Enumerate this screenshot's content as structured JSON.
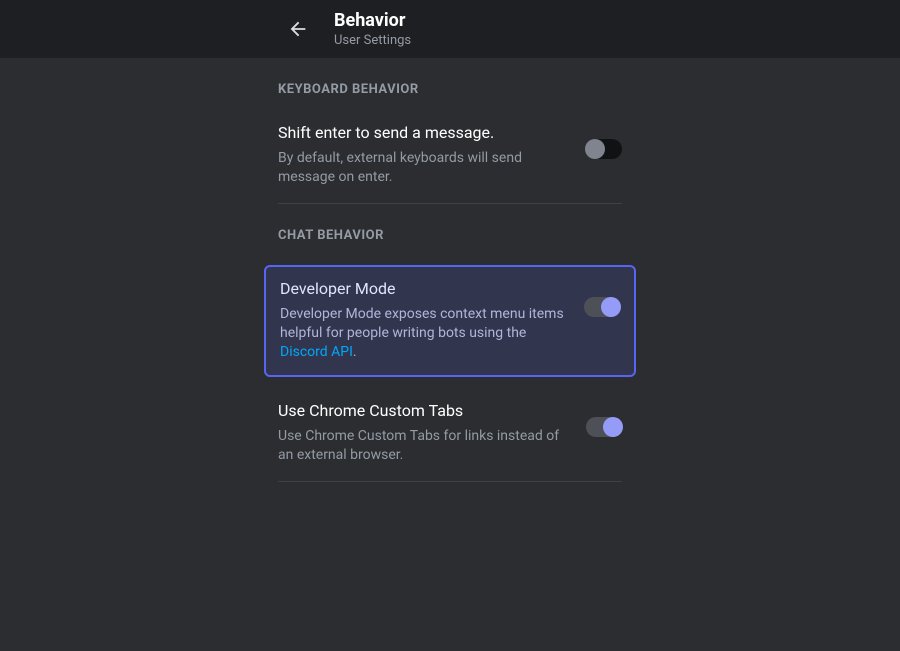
{
  "header": {
    "title": "Behavior",
    "subtitle": "User Settings"
  },
  "sections": {
    "keyboard": {
      "header": "KEYBOARD BEHAVIOR",
      "shiftEnter": {
        "title": "Shift enter to send a message.",
        "desc": "By default, external keyboards will send message on enter.",
        "enabled": false
      }
    },
    "chat": {
      "header": "CHAT BEHAVIOR",
      "developerMode": {
        "title": "Developer Mode",
        "descPrefix": "Developer Mode exposes context menu items helpful for people writing bots using the ",
        "linkText": "Discord API",
        "descSuffix": ".",
        "enabled": true
      },
      "chromeTabs": {
        "title": "Use Chrome Custom Tabs",
        "desc": "Use Chrome Custom Tabs for links instead of an external browser.",
        "enabled": true
      }
    }
  }
}
